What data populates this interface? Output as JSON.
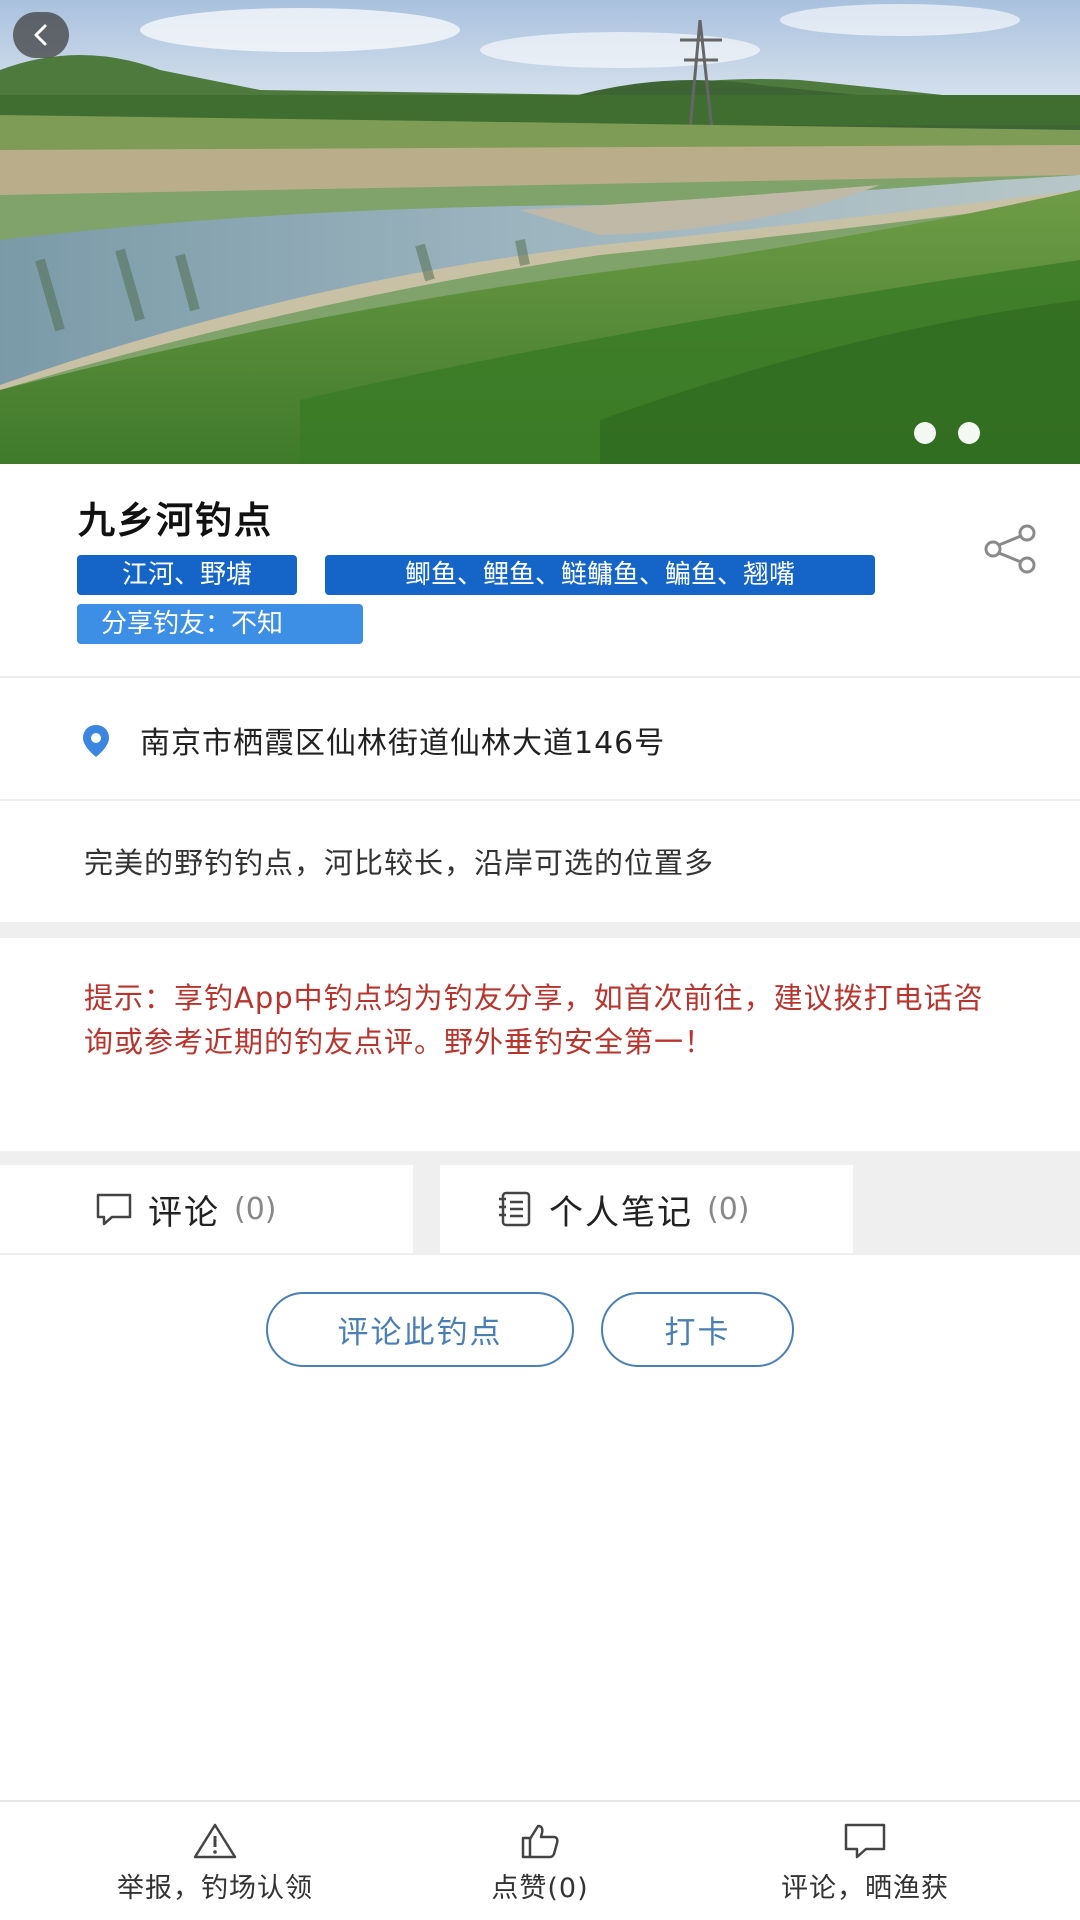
{
  "spot": {
    "title": "九乡河钓点",
    "tags": {
      "water_type": "江河、野塘",
      "fish": "鲫鱼、鲤鱼、鲢鳙鱼、鳊鱼、翘嘴",
      "sharer": "分享钓友：不知"
    },
    "address": "南京市栖霞区仙林街道仙林大道146号",
    "description": "完美的野钓钓点，河比较长，沿岸可选的位置多",
    "notice": "提示：享钓App中钓点均为钓友分享，如首次前往，建议拨打电话咨询或参考近期的钓友点评。野外垂钓安全第一！"
  },
  "tabs": [
    {
      "label": "评论",
      "count": "(0)",
      "icon": "comment-icon"
    },
    {
      "label": "个人笔记",
      "count": "(0)",
      "icon": "notebook-icon"
    }
  ],
  "actions": {
    "review": "评论此钓点",
    "checkin": "打卡"
  },
  "bottom_bar": {
    "report": "举报，钓场认领",
    "like": "点赞(0)",
    "comment": "评论，晒渔获"
  },
  "carousel": {
    "slides": 2,
    "current": 1
  },
  "colors": {
    "tag_dark": "#1565c9",
    "tag_light": "#3d8ee5",
    "notice": "#b8352e",
    "button_outline": "#4a7fb5"
  }
}
